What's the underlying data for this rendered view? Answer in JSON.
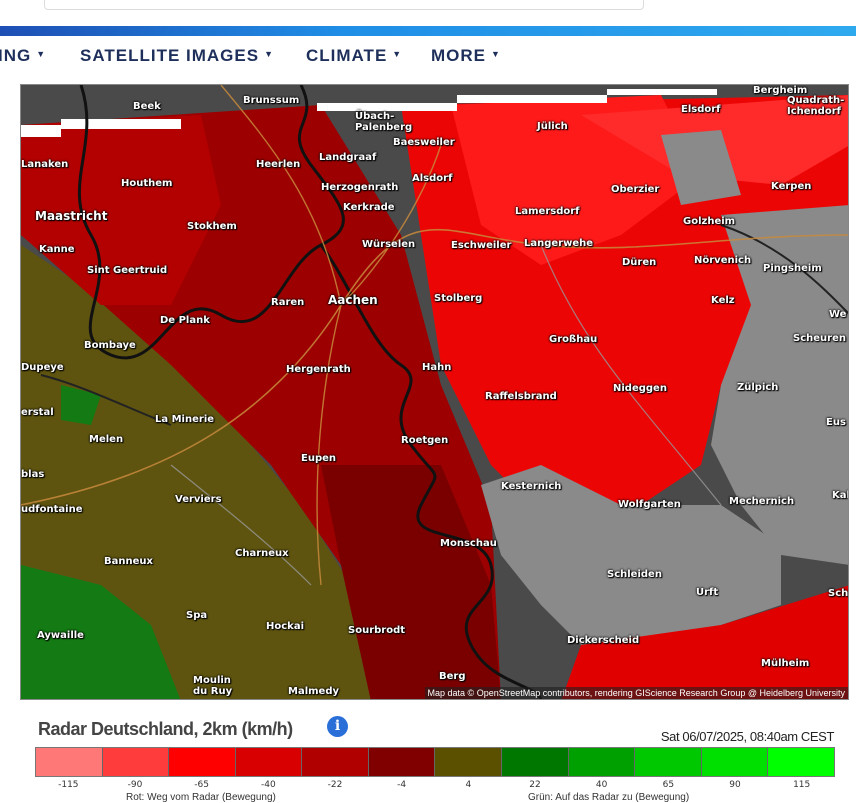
{
  "nav": {
    "items": [
      {
        "label": "ING"
      },
      {
        "label": "SATELLITE IMAGES"
      },
      {
        "label": "CLIMATE"
      },
      {
        "label": "MORE"
      }
    ]
  },
  "map": {
    "places": [
      "Beek",
      "Brunssum",
      "Übach-Palenberg",
      "Elsdorf",
      "Bergheim",
      "Quadrath-Ichendorf",
      "Baesweiler",
      "Jülich",
      "Lanaken",
      "Heerlen",
      "Landgraaf",
      "Houthem",
      "Alsdorf",
      "Herzogenrath",
      "Kerkrade",
      "Oberzier",
      "Kerpen",
      "Maastricht",
      "Lamersdorf",
      "Golzheim",
      "Stokhem",
      "Würselen",
      "Eschweiler",
      "Langerwehe",
      "Kanne",
      "Düren",
      "Nörvenich",
      "Pingsheim",
      "Sint Geertruid",
      "Raren",
      "Aachen",
      "Stolberg",
      "Kelz",
      "De Plank",
      "We",
      "Bombaye",
      "Großhau",
      "Scheuren",
      "Dupeye",
      "Hergenrath",
      "Hahn",
      "Nideggen",
      "Zülpich",
      "Raffelsbrand",
      "erstal",
      "La Minerie",
      "Eus",
      "Melen",
      "Roetgen",
      "Eupen",
      "blas",
      "Kesternich",
      "Verviers",
      "Wolfgarten",
      "Mechernich",
      "Kal",
      "udfontaine",
      "Monschau",
      "Charneux",
      "Banneux",
      "Schleiden",
      "Sch",
      "Urft",
      "Spa",
      "Hockai",
      "Dickerscheid",
      "Aywaille",
      "Sourbrodt",
      "Mülheim",
      "Berg",
      "Moulin du Ruy",
      "Malmedy"
    ],
    "attribution": "Map data © OpenStreetMap contributors, rendering GIScience Research Group @ Heidelberg University"
  },
  "legend": {
    "title": "Radar Deutschland, 2km (km/h)",
    "timestamp": "Sat 06/07/2025, 08:40am CEST",
    "ticks": [
      "-115",
      "-90",
      "-65",
      "-40",
      "-22",
      "-4",
      "4",
      "22",
      "40",
      "65",
      "90",
      "115"
    ],
    "colors": [
      "#ff7878",
      "#ff3c3c",
      "#ff0000",
      "#d80000",
      "#b00000",
      "#800000",
      "#5a5000",
      "#007800",
      "#00a000",
      "#00c800",
      "#00e000",
      "#00ff00"
    ],
    "note_left": "Rot: Weg vom Radar (Bewegung)",
    "note_right": "Grün: Auf das Radar zu (Bewegung)"
  }
}
